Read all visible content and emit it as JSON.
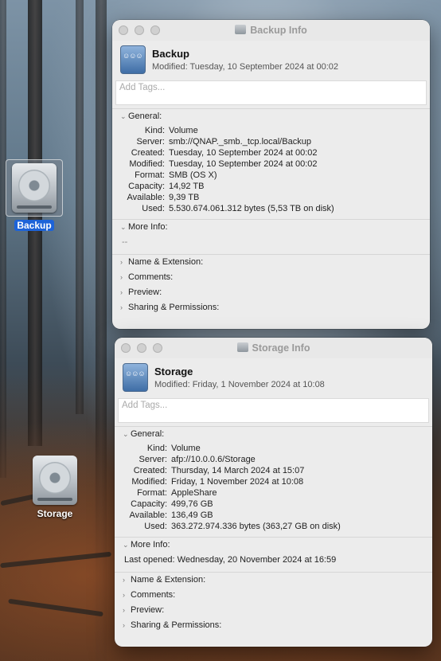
{
  "desktop": {
    "icons": [
      {
        "label": "Backup"
      },
      {
        "label": "Storage"
      }
    ]
  },
  "windows": [
    {
      "title": "Backup Info",
      "name": "Backup",
      "modified": "Modified: Tuesday, 10 September 2024 at 00:02",
      "tags_placeholder": "Add Tags...",
      "general_label": "General:",
      "props": [
        {
          "k": "Kind:",
          "v": "Volume"
        },
        {
          "k": "Server:",
          "v": "smb://QNAP._smb._tcp.local/Backup"
        },
        {
          "k": "Created:",
          "v": "Tuesday, 10 September 2024 at 00:02"
        },
        {
          "k": "Modified:",
          "v": "Tuesday, 10 September 2024 at 00:02"
        },
        {
          "k": "Format:",
          "v": "SMB (OS X)"
        },
        {
          "k": "Capacity:",
          "v": "14,92 TB"
        },
        {
          "k": "Available:",
          "v": "9,39 TB"
        },
        {
          "k": "Used:",
          "v": "5.530.674.061.312 bytes (5,53 TB on disk)"
        }
      ],
      "more_info_label": "More Info:",
      "more_info_text": "--",
      "name_ext_label": "Name & Extension:",
      "comments_label": "Comments:",
      "preview_label": "Preview:",
      "sharing_label": "Sharing & Permissions:"
    },
    {
      "title": "Storage Info",
      "name": "Storage",
      "modified": "Modified: Friday, 1 November 2024 at 10:08",
      "tags_placeholder": "Add Tags...",
      "general_label": "General:",
      "props": [
        {
          "k": "Kind:",
          "v": "Volume"
        },
        {
          "k": "Server:",
          "v": "afp://10.0.0.6/Storage"
        },
        {
          "k": "Created:",
          "v": "Thursday, 14 March 2024 at 15:07"
        },
        {
          "k": "Modified:",
          "v": "Friday, 1 November 2024 at 10:08"
        },
        {
          "k": "Format:",
          "v": "AppleShare"
        },
        {
          "k": "Capacity:",
          "v": "499,76 GB"
        },
        {
          "k": "Available:",
          "v": "136,49 GB"
        },
        {
          "k": "Used:",
          "v": "363.272.974.336 bytes (363,27 GB on disk)"
        }
      ],
      "more_info_label": "More Info:",
      "more_info_text": "Last opened: Wednesday, 20 November 2024 at 16:59",
      "name_ext_label": "Name & Extension:",
      "comments_label": "Comments:",
      "preview_label": "Preview:",
      "sharing_label": "Sharing & Permissions:"
    }
  ]
}
